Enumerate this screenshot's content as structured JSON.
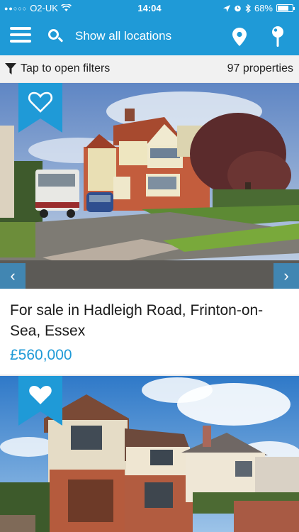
{
  "status_bar": {
    "carrier": "O2-UK",
    "time": "14:04",
    "battery": "68%",
    "battery_level": 0.68
  },
  "nav": {
    "search_label": "Show all locations"
  },
  "filters": {
    "label": "Tap to open filters",
    "count": "97 properties"
  },
  "listings": [
    {
      "title": "For sale in Hadleigh Road, Frinton-on-Sea, Essex",
      "price": "£560,000",
      "favourited": false
    },
    {
      "favourited": true
    }
  ],
  "colors": {
    "brand": "#1f9ad7"
  }
}
